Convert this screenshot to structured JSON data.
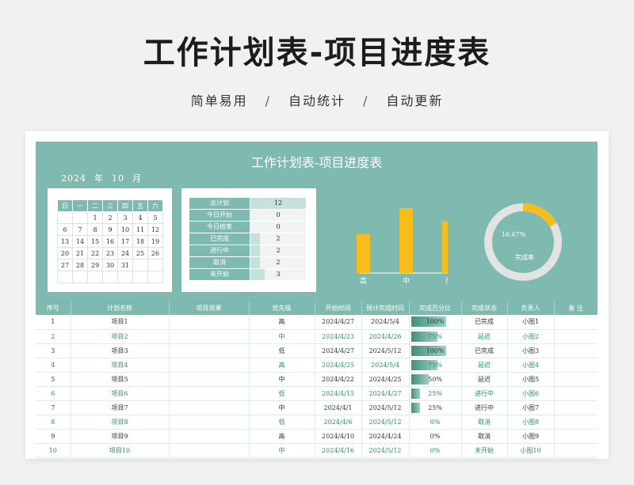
{
  "header": {
    "title": "工作计划表-项目进度表",
    "tagline": [
      "简单易用",
      "自动统计",
      "自动更新"
    ],
    "separator": "/"
  },
  "sheet": {
    "title": "工作计划表-项目进度表",
    "year": "2024",
    "year_unit": "年",
    "month": "10",
    "month_unit": "月"
  },
  "calendar": {
    "weekdays": [
      "日",
      "一",
      "二",
      "三",
      "四",
      "五",
      "六"
    ],
    "weeks": [
      [
        "",
        "",
        "1",
        "2",
        "3",
        "4",
        "5"
      ],
      [
        "6",
        "7",
        "8",
        "9",
        "10",
        "11",
        "12"
      ],
      [
        "13",
        "14",
        "15",
        "16",
        "17",
        "18",
        "19"
      ],
      [
        "20",
        "21",
        "22",
        "23",
        "24",
        "25",
        "26"
      ],
      [
        "27",
        "28",
        "29",
        "30",
        "31",
        "",
        ""
      ],
      [
        "",
        "",
        "",
        "",
        "",
        "",
        ""
      ]
    ]
  },
  "stats": [
    {
      "label": "总计划",
      "value": 12,
      "fill": 1.0
    },
    {
      "label": "今日开始",
      "value": 0,
      "fill": 0
    },
    {
      "label": "今日结束",
      "value": 0,
      "fill": 0
    },
    {
      "label": "已完成",
      "value": 2,
      "fill": 0.17
    },
    {
      "label": "进行中",
      "value": 2,
      "fill": 0.17
    },
    {
      "label": "取消",
      "value": 2,
      "fill": 0.17
    },
    {
      "label": "未开始",
      "value": 3,
      "fill": 0.25
    }
  ],
  "chart_data": [
    {
      "type": "bar",
      "categories": [
        "高",
        "中",
        "低"
      ],
      "values": [
        3,
        5,
        4
      ],
      "title": "",
      "xlabel": "",
      "ylabel": "",
      "ylim": [
        0,
        5.5
      ],
      "color": "#f8bd1a"
    },
    {
      "type": "pie",
      "categories": [
        "完成率",
        ""
      ],
      "values": [
        16.67,
        83.33
      ],
      "value_label": "16.67%",
      "center_label": "完成率",
      "colors": [
        "#f8bd1a",
        "#e3e3e3"
      ]
    }
  ],
  "table": {
    "columns": [
      "序号",
      "计划名称",
      "项目效果",
      "优先级",
      "开始时间",
      "预计完成时间",
      "完成百分比",
      "完成状态",
      "负责人",
      "备  注"
    ],
    "rows": [
      {
        "no": "1",
        "name": "项目1",
        "effect": "",
        "priority": "高",
        "start": "2024/4/27",
        "end": "2024/5/4",
        "pct_label": "100%",
        "pct": 1.0,
        "status": "已完成",
        "owner": "小图1",
        "note": ""
      },
      {
        "no": "2",
        "name": "项目2",
        "effect": "",
        "priority": "中",
        "start": "2024/4/23",
        "end": "2024/4/26",
        "pct_label": "75%",
        "pct": 0.75,
        "status": "延迟",
        "owner": "小图2",
        "note": ""
      },
      {
        "no": "3",
        "name": "项目3",
        "effect": "",
        "priority": "低",
        "start": "2024/4/27",
        "end": "2024/5/12",
        "pct_label": "100%",
        "pct": 1.0,
        "status": "已完成",
        "owner": "小图3",
        "note": ""
      },
      {
        "no": "4",
        "name": "项目4",
        "effect": "",
        "priority": "高",
        "start": "2024/4/25",
        "end": "2024/5/4",
        "pct_label": "75%",
        "pct": 0.75,
        "status": "延迟",
        "owner": "小图4",
        "note": ""
      },
      {
        "no": "5",
        "name": "项目5",
        "effect": "",
        "priority": "中",
        "start": "2024/4/22",
        "end": "2024/4/25",
        "pct_label": "50%",
        "pct": 0.5,
        "status": "延迟",
        "owner": "小图5",
        "note": ""
      },
      {
        "no": "6",
        "name": "项目6",
        "effect": "",
        "priority": "低",
        "start": "2024/4/15",
        "end": "2024/4/27",
        "pct_label": "25%",
        "pct": 0.25,
        "status": "进行中",
        "owner": "小图6",
        "note": ""
      },
      {
        "no": "7",
        "name": "项目7",
        "effect": "",
        "priority": "中",
        "start": "2024/4/1",
        "end": "2024/5/12",
        "pct_label": "25%",
        "pct": 0.25,
        "status": "进行中",
        "owner": "小图7",
        "note": ""
      },
      {
        "no": "8",
        "name": "项目8",
        "effect": "",
        "priority": "低",
        "start": "2024/4/6",
        "end": "2024/5/12",
        "pct_label": "0%",
        "pct": 0,
        "status": "取消",
        "owner": "小图8",
        "note": ""
      },
      {
        "no": "9",
        "name": "项目9",
        "effect": "",
        "priority": "高",
        "start": "2024/4/10",
        "end": "2024/4/24",
        "pct_label": "0%",
        "pct": 0,
        "status": "取消",
        "owner": "小图9",
        "note": ""
      },
      {
        "no": "10",
        "name": "项目10",
        "effect": "",
        "priority": "中",
        "start": "2024/4/16",
        "end": "2024/5/12",
        "pct_label": "0%",
        "pct": 0,
        "status": "未开始",
        "owner": "小图10",
        "note": ""
      }
    ]
  },
  "colors": {
    "accent": "#7fbab0",
    "bar": "#f8bd1a",
    "ring_bg": "#e3e3e3",
    "row_alt_text": "#2e8b6a"
  }
}
